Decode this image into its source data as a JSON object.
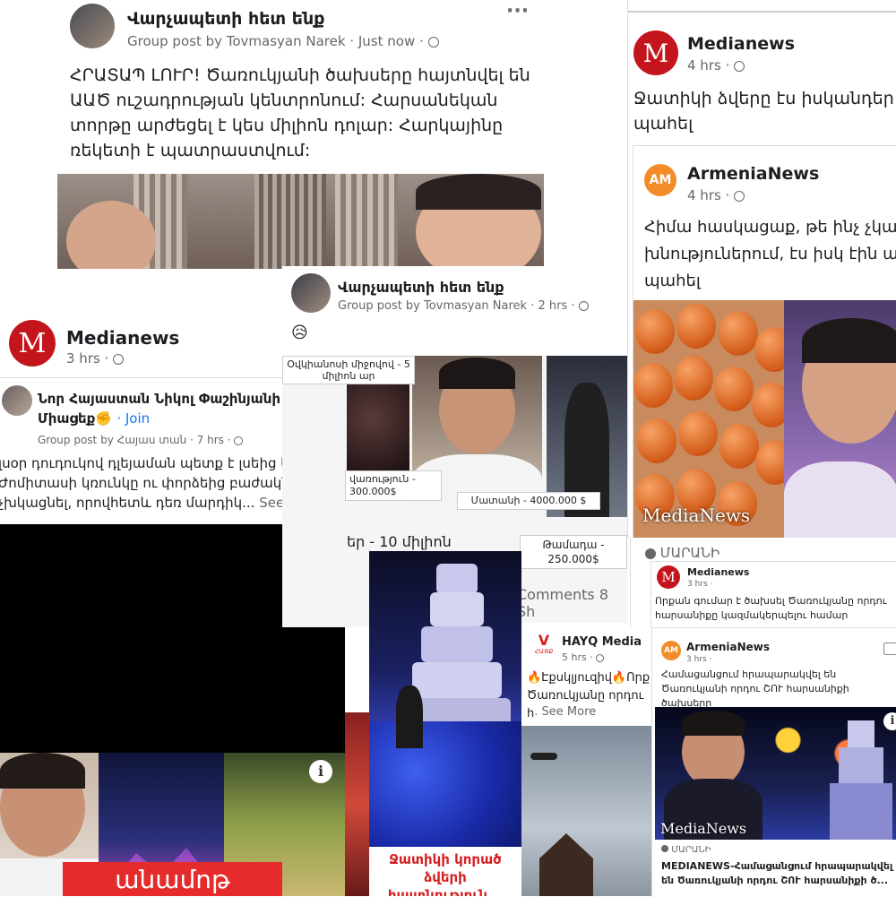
{
  "post1": {
    "group": "Վարչապետի հետ ենք",
    "meta": "Group post by Tovmasyan Narek · Just now ·",
    "text": "ՀՐԱՏԱՊ ԼՈՒՐ! Ծառուկյանի ծախսերը հայտնվել են ԱԱԾ ուշադրության կենտրոնում: Հարսանեկան տորթը արժեցել է կես միլիոն դոլար: Հարկայինը ռեկետի է պատրաստվում:",
    "more_icon": "···"
  },
  "post2": {
    "source": "Medianews",
    "meta": "4 hrs ·",
    "text": "Ջատիկի ձվերը էս իսկանդեր պահել",
    "shared_source": "ArmeniaNews",
    "shared_meta": "4 hrs ·",
    "shared_text": "Հիմա հասկացաք, թե ինչ չկար խնություներում, էս իսկ էին առել-պահել",
    "watermark": "MediaNews",
    "badge": "ՄԱՐԱՆԻ"
  },
  "post3": {
    "group": "Վարչապետի հետ ենք",
    "meta": "Group post by Tovmasyan Narek · 2 hrs ·",
    "emoji": "😥",
    "labels": [
      "Օվկիանոսի միջովով - 5 միլիոն ար",
      "վառություն - 300.000$",
      "Մատանի - 4000.000 $",
      "Թամադա - 250.000$",
      "եր - 10 միլիոն"
    ],
    "comments": "Comments 8 Sh"
  },
  "post4": {
    "source": "Medianews",
    "meta": "3 hrs ·",
    "shared_group": "Նոր Հայաստան Նիկոլ Փաշինյանի հետ🇦🇲Միացեք✊",
    "join": "· Join",
    "shared_meta": "Group post by Հայաս տան · 7 hrs ·",
    "text": "լսօր դուդուկով դլեյաման պետք է լսեից կամ Ժոմիտաuի կռունկը ու փորձեից բաժակները չխկացնել, որովհետև դեռ մարդիկ...",
    "see_more": "See More",
    "banner": "անամոթ",
    "info": "i"
  },
  "post5": {
    "source": "Medianews",
    "meta": "3 hrs ·",
    "text": "Որքան գումար է ծախսել Ծառուկյանը որդու հարսանիքը կազմակերպելու համար"
  },
  "post6": {
    "source": "ArmeniaNews",
    "meta": "3 hrs ·",
    "text": "Համացանցում հրապարակվել են Ծառուկյանի որդու ՇՈՒ հարսանիքի ծախսերը",
    "watermark": "MediaNews",
    "badge": "ՄԱՐԱՆԻ",
    "headline": "MEDIANEWS-Համացանցում հրապարակվել են Ծառուկյանի որդու ՇՈՒ հարսանիքի ծ...",
    "info": "i"
  },
  "post7": {
    "source": "HAYQ Media",
    "meta": "5 hrs ·",
    "text": "🔥Էքսկլյուզիվ🔥Որք Ծառուկյանը որդու հ",
    "see_more": "... See More",
    "logo_text": "ՀԱՅՔ"
  },
  "post8": {
    "caption": "Ջատիկի կորած ձվերի հայտնություն..."
  },
  "colors": {
    "fb_blue": "#1877f2",
    "medianews_red": "#c4151c",
    "am_orange": "#f28c28"
  }
}
